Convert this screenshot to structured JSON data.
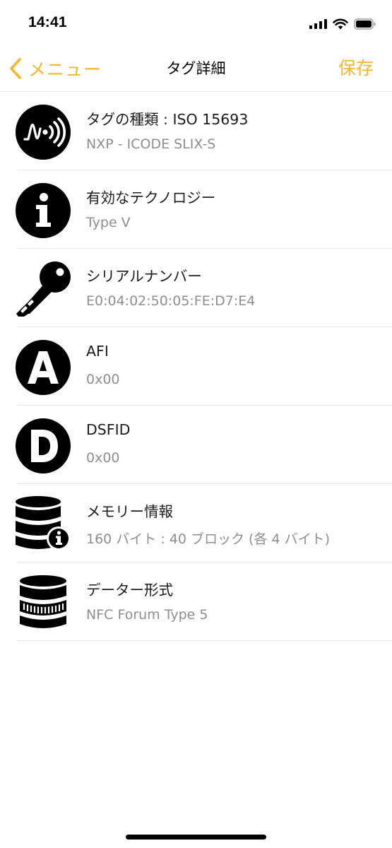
{
  "status_bar": {
    "time": "14:41",
    "icons": [
      "cellular-signal-icon",
      "wifi-icon",
      "battery-icon"
    ]
  },
  "nav": {
    "back_label": "メニュー",
    "title": "タグ詳細",
    "save_label": "保存",
    "accent_color": "#F5B52F"
  },
  "rows": [
    {
      "icon": "nfc-tag-icon",
      "title": "タグの種類 : ISO 15693",
      "subtitle": "NXP - ICODE SLIX-S"
    },
    {
      "icon": "info-icon",
      "title": "有効なテクノロジー",
      "subtitle": "Type V"
    },
    {
      "icon": "key-icon",
      "title": "シリアルナンバー",
      "subtitle": "E0:04:02:50:05:FE:D7:E4"
    },
    {
      "icon": "letter-a-icon",
      "title": "AFI",
      "subtitle": "0x00"
    },
    {
      "icon": "letter-d-icon",
      "title": "DSFID",
      "subtitle": "0x00"
    },
    {
      "icon": "database-info-icon",
      "title": "メモリー情報",
      "subtitle": "160 バイト : 40 ブロック (各 4 バイト)"
    },
    {
      "icon": "database-icon",
      "title": "データー形式",
      "subtitle": "NFC Forum Type 5"
    }
  ]
}
